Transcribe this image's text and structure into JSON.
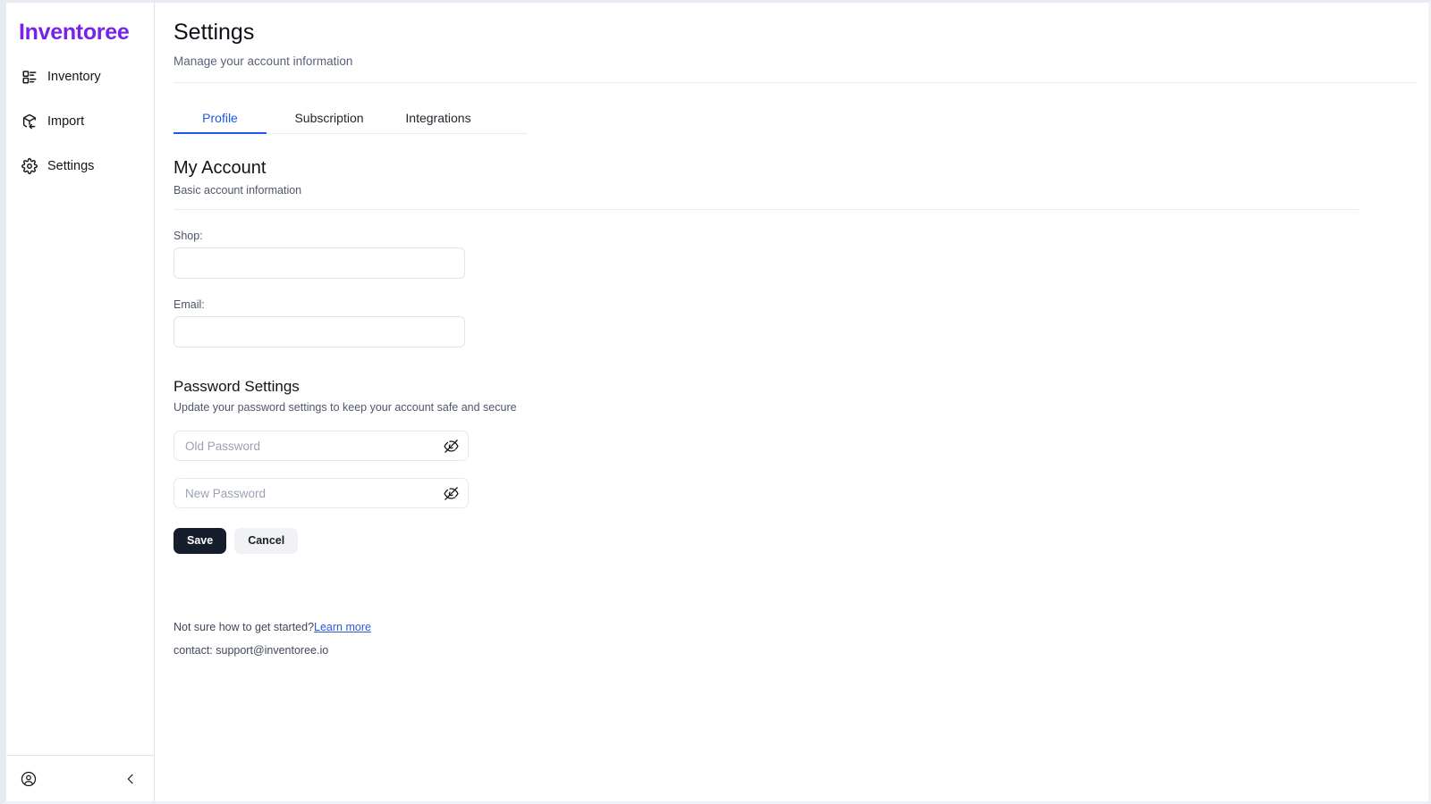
{
  "brand": {
    "name": "Inventoree",
    "color": "#7722e8"
  },
  "sidebar": {
    "items": [
      {
        "label": "Inventory",
        "icon": "layout-list-icon"
      },
      {
        "label": "Import",
        "icon": "package-import-icon"
      },
      {
        "label": "Settings",
        "icon": "gear-icon"
      }
    ],
    "footer": {
      "account_icon": "user-circle-icon",
      "collapse_icon": "chevron-left-icon"
    }
  },
  "header": {
    "title": "Settings",
    "subtitle": "Manage your account information"
  },
  "tabs": [
    {
      "label": "Profile",
      "active": true
    },
    {
      "label": "Subscription",
      "active": false
    },
    {
      "label": "Integrations",
      "active": false
    }
  ],
  "account_section": {
    "title": "My Account",
    "subtitle": "Basic account information",
    "fields": [
      {
        "label": "Shop:",
        "value": "",
        "placeholder": ""
      },
      {
        "label": "Email:",
        "value": "",
        "placeholder": ""
      }
    ]
  },
  "password_section": {
    "title": "Password Settings",
    "subtitle": "Update your password settings to keep your account safe and secure",
    "old_password": {
      "value": "",
      "placeholder": "Old Password",
      "toggle_icon": "eye-off-icon"
    },
    "new_password": {
      "value": "",
      "placeholder": "New Password",
      "toggle_icon": "eye-off-icon"
    },
    "save_label": "Save",
    "cancel_label": "Cancel"
  },
  "footer": {
    "help_text": "Not sure how to get started?",
    "help_link": "Learn more",
    "contact": "contact: support@inventoree.io"
  },
  "colors": {
    "accent_purple": "#7722e8",
    "accent_blue": "#1b58ec",
    "save_dark": "#161e2e",
    "link_blue": "#2b5ae0"
  }
}
